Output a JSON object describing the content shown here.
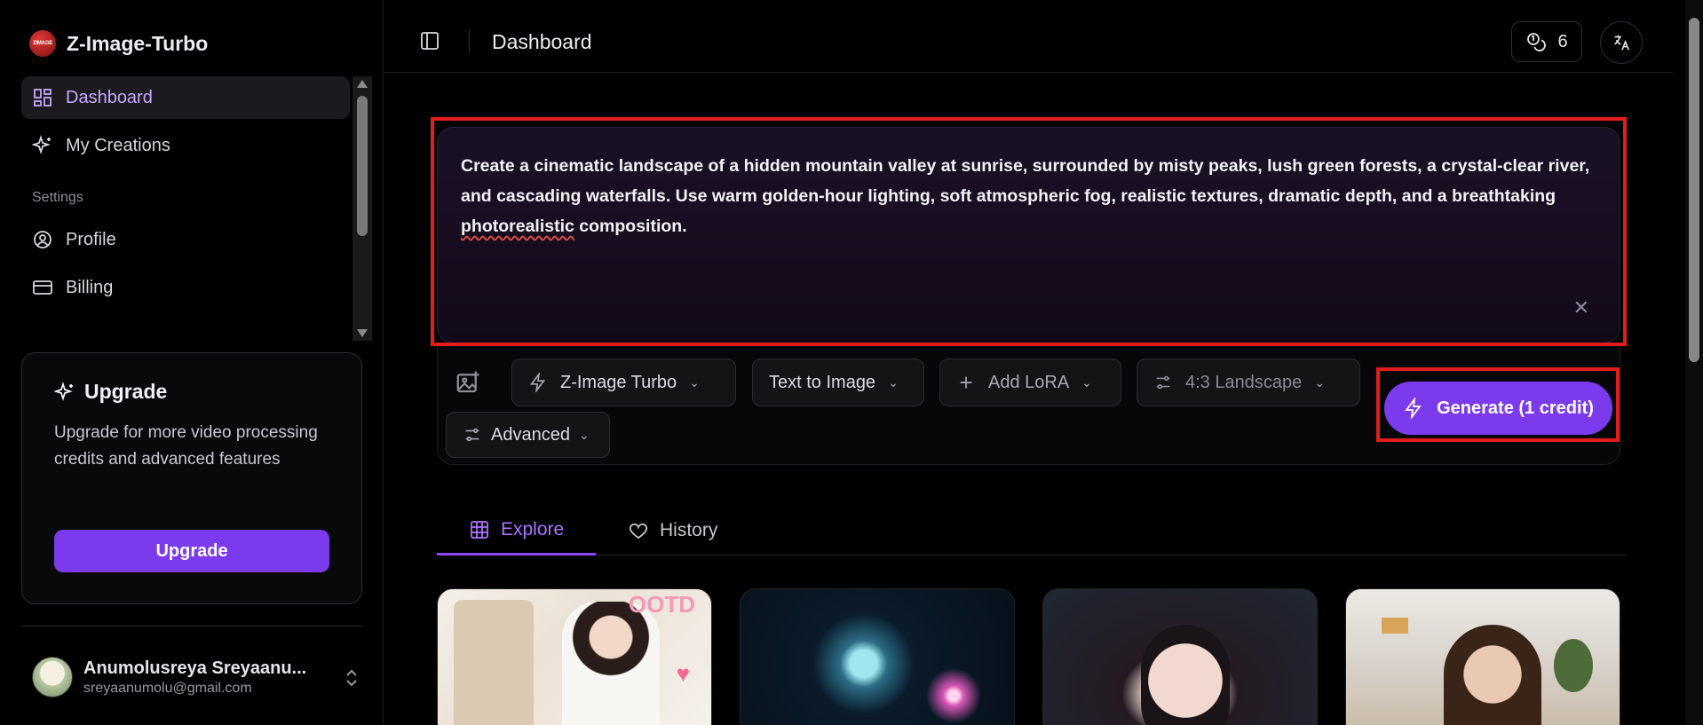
{
  "brand": {
    "name": "Z-Image-Turbo",
    "logo_text": "ZIMAGE"
  },
  "sidebar": {
    "items": [
      {
        "label": "Dashboard"
      },
      {
        "label": "My Creations"
      }
    ],
    "section_label": "Settings",
    "settings_items": [
      {
        "label": "Profile"
      },
      {
        "label": "Billing"
      }
    ],
    "upgrade": {
      "title": "Upgrade",
      "text": "Upgrade for more video processing credits and advanced features",
      "button": "Upgrade"
    },
    "user": {
      "name": "Anumolusreya Sreyaanu...",
      "email": "sreyaanumolu@gmail.com"
    }
  },
  "header": {
    "title": "Dashboard",
    "credits": "6",
    "language_icon": "translate-icon"
  },
  "prompt": {
    "text_before": "Create a cinematic landscape of a hidden mountain valley at sunrise, surrounded by misty peaks, lush green forests, a crystal-clear river, and cascading waterfalls. Use warm golden-hour lighting, soft atmospheric fog, realistic textures, dramatic depth, and a breathtaking ",
    "text_misspelled": "photorealistic",
    "text_after": " composition."
  },
  "toolbar": {
    "model": "Z-Image Turbo",
    "mode": "Text to Image",
    "lora": "Add LoRA",
    "aspect": "4:3 Landscape",
    "advanced": "Advanced",
    "generate": "Generate (1 credit)"
  },
  "tabs": [
    {
      "label": "Explore",
      "active": true
    },
    {
      "label": "History",
      "active": false
    }
  ],
  "gallery": {
    "card1_text": "OOTD"
  },
  "colors": {
    "accent": "#7c3aed",
    "accent_text": "#a974ff",
    "highlight": "#e11d1d"
  }
}
